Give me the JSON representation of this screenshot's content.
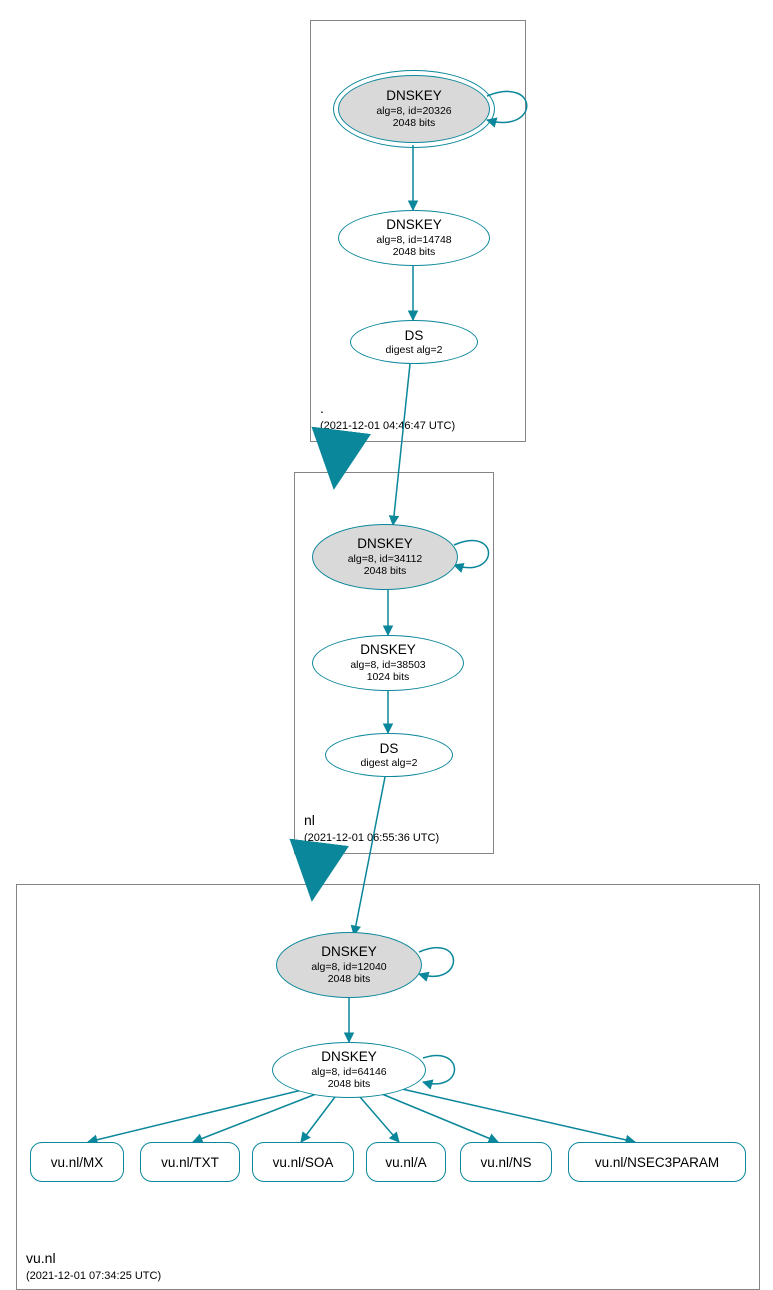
{
  "zones": {
    "root": {
      "label": ".",
      "timestamp": "(2021-12-01 04:46:47 UTC)",
      "ksk": {
        "title": "DNSKEY",
        "alg": "alg=8, id=20326",
        "bits": "2048 bits"
      },
      "zsk": {
        "title": "DNSKEY",
        "alg": "alg=8, id=14748",
        "bits": "2048 bits"
      },
      "ds": {
        "title": "DS",
        "digest": "digest alg=2"
      }
    },
    "nl": {
      "label": "nl",
      "timestamp": "(2021-12-01 06:55:36 UTC)",
      "ksk": {
        "title": "DNSKEY",
        "alg": "alg=8, id=34112",
        "bits": "2048 bits"
      },
      "zsk": {
        "title": "DNSKEY",
        "alg": "alg=8, id=38503",
        "bits": "1024 bits"
      },
      "ds": {
        "title": "DS",
        "digest": "digest alg=2"
      }
    },
    "vunl": {
      "label": "vu.nl",
      "timestamp": "(2021-12-01 07:34:25 UTC)",
      "ksk": {
        "title": "DNSKEY",
        "alg": "alg=8, id=12040",
        "bits": "2048 bits"
      },
      "zsk": {
        "title": "DNSKEY",
        "alg": "alg=8, id=64146",
        "bits": "2048 bits"
      }
    }
  },
  "records": {
    "mx": "vu.nl/MX",
    "txt": "vu.nl/TXT",
    "soa": "vu.nl/SOA",
    "a": "vu.nl/A",
    "ns": "vu.nl/NS",
    "nsec": "vu.nl/NSEC3PARAM"
  },
  "colors": {
    "stroke": "#0a879a",
    "box": "#858585"
  }
}
